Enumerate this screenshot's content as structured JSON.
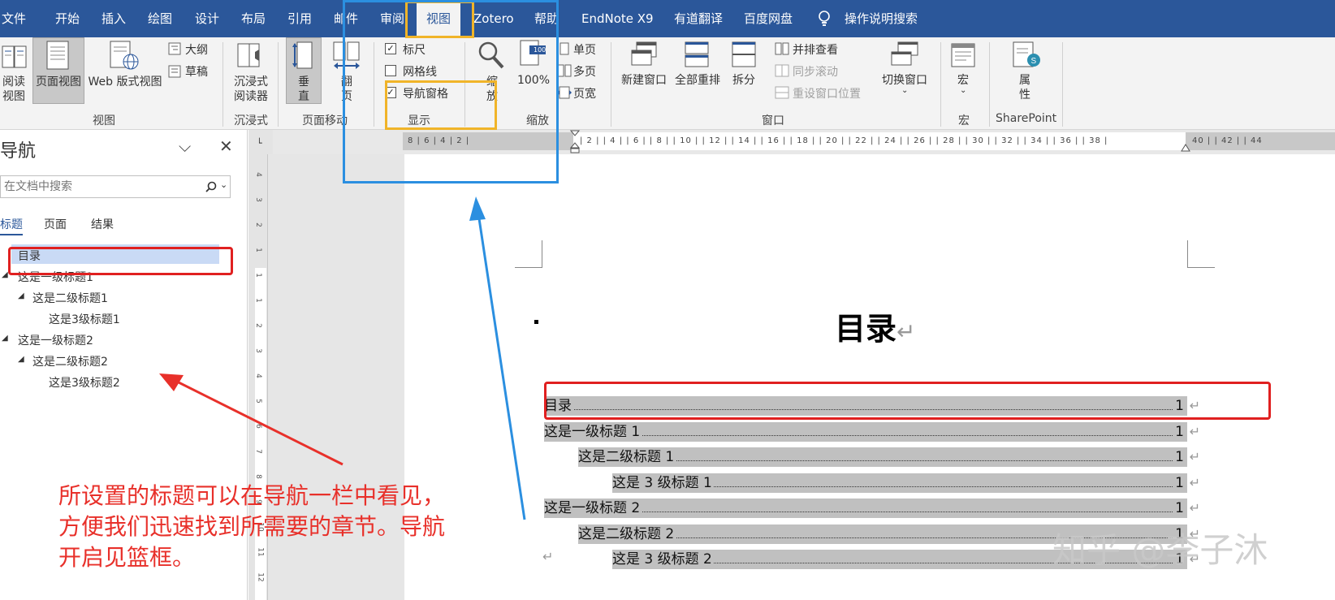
{
  "tabs": [
    "文件",
    "开始",
    "插入",
    "绘图",
    "设计",
    "布局",
    "引用",
    "邮件",
    "审阅",
    "视图",
    "Zotero",
    "帮助",
    "EndNote X9",
    "有道翻译",
    "百度网盘",
    "操作说明搜索"
  ],
  "ribbon": {
    "view_group": {
      "read_mode": "阅读视图",
      "read_mode_l1": "阅读",
      "read_mode_l2": "视图",
      "print_layout": "页面视图",
      "web_layout": "Web 版式视图",
      "outline": "大纲",
      "draft": "草稿",
      "label": "视图"
    },
    "immersive_group": {
      "reader_l1": "沉浸式",
      "reader_l2": "阅读器",
      "label": "沉浸式"
    },
    "page_move_group": {
      "vertical_l1": "垂",
      "vertical_l2": "直",
      "flip_l1": "翻",
      "flip_l2": "页",
      "label": "页面移动"
    },
    "show_group": {
      "ruler": "标尺",
      "gridlines": "网格线",
      "nav_pane": "导航窗格",
      "ruler_checked": true,
      "gridlines_checked": false,
      "nav_pane_checked": true,
      "label": "显示"
    },
    "zoom_group": {
      "zoom_l1": "缩",
      "zoom_l2": "放",
      "percent": "100%",
      "percent_badge": "100",
      "one_page": "单页",
      "multi_page": "多页",
      "page_width": "页宽",
      "label": "缩放"
    },
    "window_group": {
      "new_window": "新建窗口",
      "arrange_all": "全部重排",
      "split": "拆分",
      "side_by_side": "并排查看",
      "sync_scroll": "同步滚动",
      "reset_position": "重设窗口位置",
      "switch_windows": "切换窗口",
      "label": "窗口"
    },
    "macros_group": {
      "macros": "宏",
      "label": "宏"
    },
    "sharepoint_group": {
      "properties_l1": "属",
      "properties_l2": "性",
      "label": "SharePoint"
    }
  },
  "nav": {
    "title": "导航",
    "search_placeholder": "在文档中搜索",
    "tabs": [
      "标题",
      "页面",
      "结果"
    ],
    "items": [
      {
        "label": "目录",
        "level": 0,
        "selected": true
      },
      {
        "label": "这是一级标题1",
        "level": 1
      },
      {
        "label": "这是二级标题1",
        "level": 2
      },
      {
        "label": "这是3级标题1",
        "level": 3
      },
      {
        "label": "这是一级标题2",
        "level": 1
      },
      {
        "label": "这是二级标题2",
        "level": 2
      },
      {
        "label": "这是3级标题2",
        "level": 3
      }
    ]
  },
  "ruler": {
    "left_numbers": "8 | 6 | 4 | 2 |",
    "right_numbers": "| 2 | | 4 | | 6 | | 8 | | 10 | | 12 | | 14 | | 16 | | 18 | | 20 | | 22 | | 24 | | 26 | | 28 | | 30 | | 32 | | 34 | | 36 | | 38 |",
    "tail_numbers": "40 | | 42 | | 44",
    "vertical_numbers": [
      "4",
      "3",
      "2",
      "1",
      "1",
      "1",
      "2",
      "3",
      "4",
      "5",
      "6",
      "7",
      "8",
      "9",
      "10",
      "11",
      "12"
    ]
  },
  "document": {
    "title": "目录",
    "return_mark": "↵",
    "toc": [
      {
        "text": "目录",
        "page": "1",
        "indent": 0
      },
      {
        "text": "这是一级标题 1",
        "page": "1",
        "indent": 0
      },
      {
        "text": "这是二级标题 1",
        "page": "1",
        "indent": 1
      },
      {
        "text": "这是 3 级标题 1",
        "page": "1",
        "indent": 2
      },
      {
        "text": "这是一级标题 2",
        "page": "1",
        "indent": 0
      },
      {
        "text": "这是二级标题 2",
        "page": "1",
        "indent": 1
      },
      {
        "text": "这是 3 级标题 2",
        "page": "1",
        "indent": 2
      }
    ]
  },
  "annotation": {
    "lines": [
      "所设置的标题可以在导航一栏中看见，",
      "方便我们迅速找到所需要的章节。导航",
      "开启见篮框。"
    ]
  },
  "watermark": "知乎 @李子沐",
  "colors": {
    "accent": "#2b579a",
    "annotation_red": "#e8302a",
    "annotation_blue": "#2b8fe0",
    "annotation_yellow": "#f0b429",
    "toc_highlight": "#c0c0c0"
  }
}
